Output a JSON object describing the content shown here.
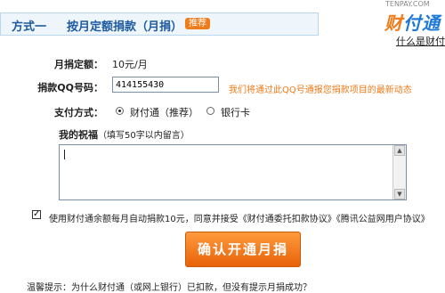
{
  "header": {
    "title": "方式一",
    "subtitle": "按月定额捐款（月捐）",
    "badge": "推荐"
  },
  "logo": {
    "small": "TENPAY.COM",
    "main_a": "财",
    "main_b": "付通"
  },
  "help_link": "什么是财付通",
  "form": {
    "monthly_label": "月捐定额：",
    "monthly_value": "10元/月",
    "qq_label": "捐款QQ号码：",
    "qq_value": "414155430",
    "qq_hint": "我们将通过此QQ号通报您捐款项目的最新动态",
    "pay_label": "支付方式：",
    "pay_options": [
      "财付通（推荐）",
      "银行卡"
    ],
    "wish_label": "我的祝福",
    "wish_note": "（填写50字以内留言）",
    "wish_value": ""
  },
  "agreement": {
    "checked": true,
    "text": "使用财付通余额每月自动捐款10元，同意并接受《财付通委托扣款协议》《腾讯公益网用户协议》"
  },
  "submit_label": "确认开通月捐",
  "bottom_tip": "温馨提示：为什么财付通（或网上银行）已扣款，但没有提示月捐成功？"
}
